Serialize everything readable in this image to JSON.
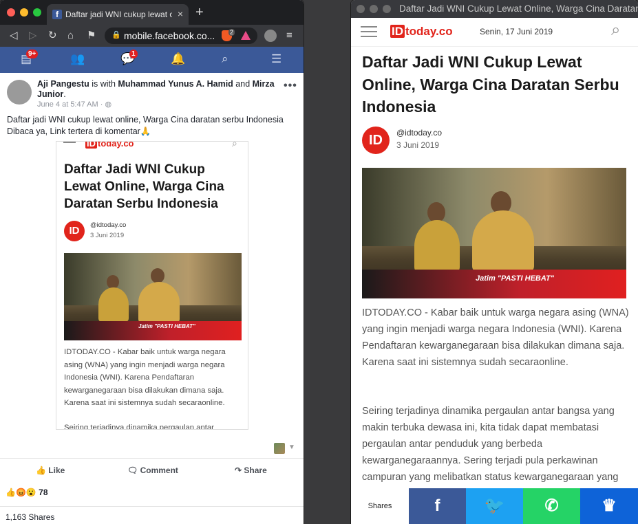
{
  "left_browser": {
    "tab_title": "Daftar jadi WNI cukup lewat online",
    "tab_favicon": "f",
    "url": "mobile.facebook.co...",
    "brave_count": "2",
    "fb_nav": {
      "home_badge": "9+",
      "messenger_badge": "1"
    },
    "post": {
      "author": "Aji Pangestu",
      "with_text": "is with",
      "tag1": "Muhammad Yunus A. Hamid",
      "and_text": "and",
      "tag2": "Mirza Junior",
      "time": "June 4 at 5:47 AM",
      "privacy_dot": "·",
      "text_line1": "Daftar jadi WNI cukup lewat online, Warga Cina daratan serbu Indonesia",
      "text_line2": "Dibaca ya, Link tertera di komentar🙏",
      "more": "•••",
      "embedded": {
        "logo": "IDtoday.co",
        "headline": "Daftar Jadi WNI Cukup Lewat Online, Warga Cina Daratan Serbu Indonesia",
        "author": "@idtoday.co",
        "date": "3 Juni 2019",
        "photo_caption": "Jatim \"PASTI HEBAT\"",
        "body": "IDTODAY.CO - Kabar baik untuk warga negara asing (WNA) yang ingin menjadi warga negara Indonesia (WNI). Karena Pendaftaran kewarganegaraan bisa dilakukan dimana saja. Karena saat ini sistemnya sudah secaraonline.",
        "body2": "Seiring terjadinya dinamika pergaulan antar"
      },
      "like_label": "Like",
      "comment_label": "Comment",
      "share_label": "Share",
      "reactions_count": "78",
      "shares_text": "1,163 Shares"
    }
  },
  "right_browser": {
    "window_title": "Daftar Jadi WNI Cukup Lewat Online, Warga Cina Daratan Serbu Indonesia",
    "site_logo": "IDtoday.co",
    "header_date": "Senin, 17 Juni 2019",
    "headline": "Daftar Jadi WNI Cukup Lewat Online, Warga Cina Daratan Serbu Indonesia",
    "author": "@idtoday.co",
    "date": "3 Juni 2019",
    "photo_caption": "Jatim \"PASTI HEBAT\"",
    "paragraph1": "IDTODAY.CO - Kabar baik untuk warga negara asing (WNA) yang ingin menjadi warga negara Indonesia (WNI). Karena Pendaftaran kewarganegaraan bisa dilakukan dimana saja. Karena saat ini sistemnya sudah secaraonline.",
    "paragraph2": "Seiring terjadinya dinamika pergaulan antar bangsa yang makin terbuka dewasa ini, kita tidak dapat membatasi pergaulan antar penduduk yang berbeda kewarganegaraannya. Sering terjadi pula perkawinan campuran yang melibatkan status kewarganegaraan yang",
    "share_label": "Shares",
    "share_buttons": {
      "facebook": "f",
      "twitter": "🐦",
      "whatsapp": "✆",
      "sumo": "♛"
    },
    "colors": {
      "facebook": "#3b5998",
      "twitter": "#1da1f2",
      "whatsapp": "#25d366",
      "sumo": "#0e63d8",
      "brand": "#e1241b"
    }
  }
}
